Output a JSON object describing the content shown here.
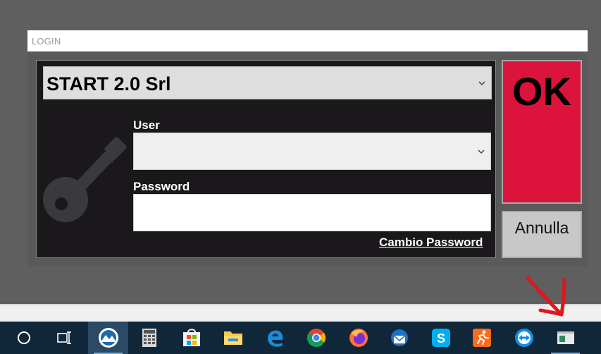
{
  "window": {
    "title": "LOGIN"
  },
  "company": {
    "selected": "START 2.0 Srl"
  },
  "user": {
    "label": "User",
    "value": ""
  },
  "password": {
    "label": "Password",
    "value": ""
  },
  "links": {
    "change_password": "Cambio Password"
  },
  "buttons": {
    "ok": "OK",
    "cancel": "Annulla"
  },
  "colors": {
    "ok_button": "#dc143c",
    "panel": "#1a181b",
    "taskbar": "#10273a",
    "annotation_arrow": "#e3141b"
  },
  "taskbar": {
    "icons": [
      "cortana-icon",
      "task-view-icon",
      "app-icon",
      "calculator-icon",
      "microsoft-store-icon",
      "file-explorer-icon",
      "edge-icon",
      "chrome-icon",
      "firefox-icon",
      "thunderbird-icon",
      "skype-icon",
      "strava-icon",
      "teamviewer-icon",
      "window-app-icon"
    ]
  }
}
